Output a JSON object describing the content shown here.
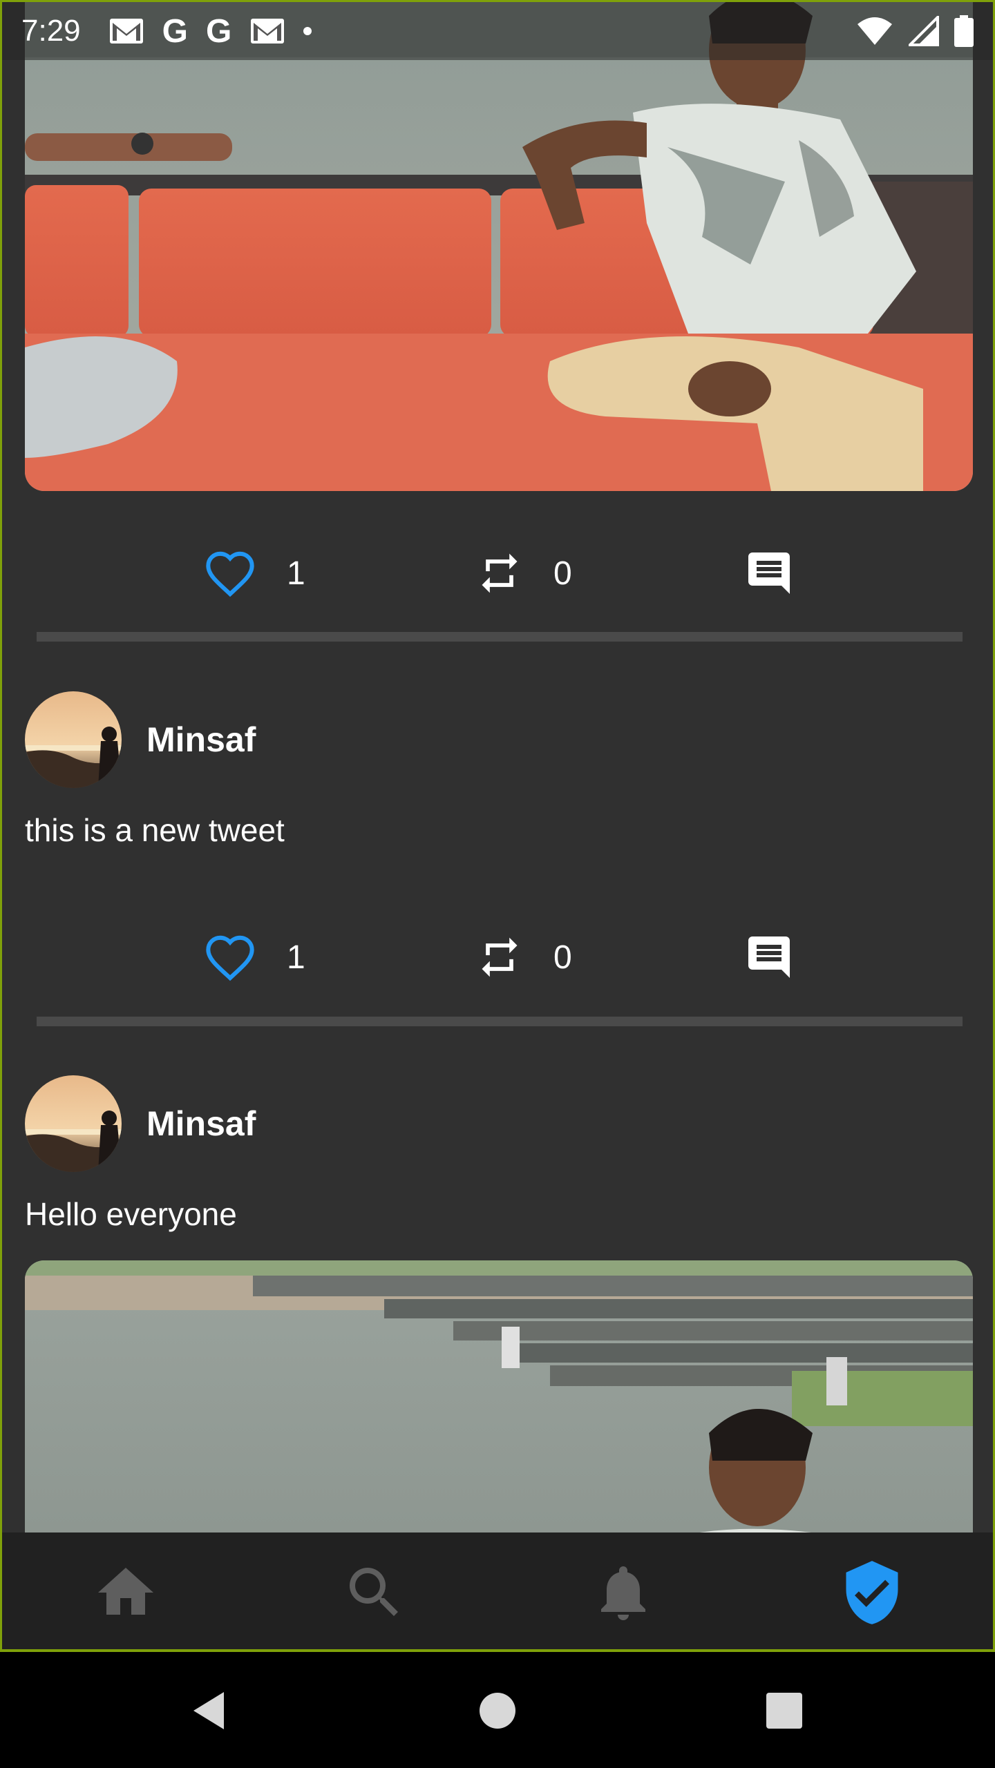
{
  "status_bar": {
    "time": "7:29",
    "notif_icons": [
      "gmail-icon",
      "google-icon",
      "google-icon",
      "gmail-icon",
      "dot-icon"
    ],
    "g1": "G",
    "g2": "G",
    "right_icons": [
      "wifi-icon",
      "signal-icon",
      "battery-icon"
    ]
  },
  "posts": [
    {
      "likes": "1",
      "retweets": "0",
      "has_image": true
    },
    {
      "author": "Minsaf",
      "text": "this is a new tweet",
      "likes": "1",
      "retweets": "0"
    },
    {
      "author": "Minsaf",
      "text": "Hello everyone",
      "has_image": true
    }
  ],
  "bottom_nav": {
    "items": [
      "home-icon",
      "search-icon",
      "bell-icon",
      "verified-shield-icon"
    ],
    "active_index": 3
  },
  "system_nav": [
    "back-icon",
    "home-circle-icon",
    "recents-icon"
  ],
  "colors": {
    "background": "#303030",
    "nav_background": "#212121",
    "accent": "#2196f3",
    "inactive_icon": "#5e5e5e",
    "divider": "#4a4a4a"
  }
}
